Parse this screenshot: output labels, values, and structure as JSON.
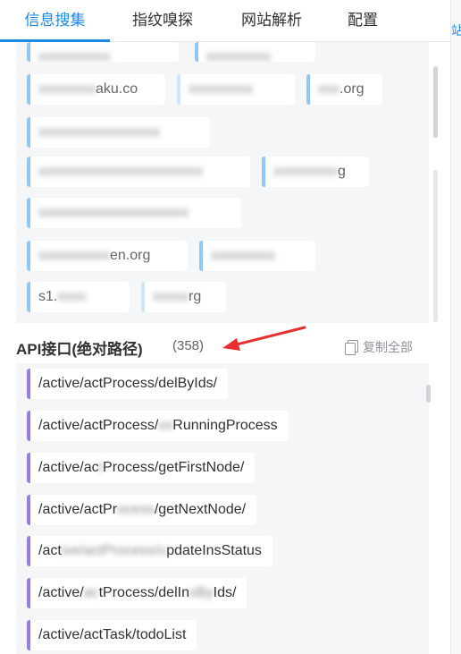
{
  "tabs": [
    {
      "label": "信息搜集",
      "active": true
    },
    {
      "label": "指纹嗅探",
      "active": false
    },
    {
      "label": "网站解析",
      "active": false
    },
    {
      "label": "配置",
      "active": false
    }
  ],
  "right_edge_fragment": "站",
  "domains": [
    {
      "clear": "",
      "blurred": "xxxxxxxxxx"
    },
    {
      "clear": "",
      "blurred": "xxxxxxxxx"
    },
    {
      "clear": "aku.co",
      "blurred": "xxxxxxxx"
    },
    {
      "clear": "",
      "blurred": "xxxxxxxxx"
    },
    {
      "clear": ".org",
      "blurred": "xxx"
    },
    {
      "clear": "",
      "blurred": "xxxxxxxxxxxxxxxxx"
    },
    {
      "clear": "",
      "blurred": "xxxxxxxxxxxxxxxxxxxxxxx"
    },
    {
      "clear": "g",
      "blurred": "xxxxxxxxx"
    },
    {
      "clear": "",
      "blurred": "xxxxxxxxxxxxxxxxxxxxx"
    },
    {
      "clear": "en.org",
      "blurred": "xxxxxxxxxx"
    },
    {
      "clear": "",
      "blurred": "xxxxxxxxx"
    },
    {
      "clear": "s1.",
      "blurred": "xxxx"
    },
    {
      "clear": "rg",
      "blurred": "xxxxx"
    }
  ],
  "api_section": {
    "title": "API接口(绝对路径)",
    "count": "(358)",
    "copy_label": "复制全部"
  },
  "api_items": [
    {
      "text": "/active/actProcess/delByIds/",
      "blurred": ""
    },
    {
      "text": "/active/actProcess/",
      "blurred": "xx",
      "tail": "RunningProcess"
    },
    {
      "text": "/active/ac",
      "blurred": "t",
      "tail": "Process/getFirstNode/"
    },
    {
      "text": "/active/actPr",
      "blurred": "ocess",
      "tail": "/getNextNode/"
    },
    {
      "text": "/act",
      "blurred": "ive/actProcess/u",
      "tail": "pdateInsStatus"
    },
    {
      "text": "/active/",
      "blurred": "ac",
      "tail": "tProcess/delIn",
      "tail_blur": "sBy",
      "tail2": "Ids/"
    },
    {
      "text": "/active/actTask/todoList",
      "blurred": ""
    }
  ]
}
